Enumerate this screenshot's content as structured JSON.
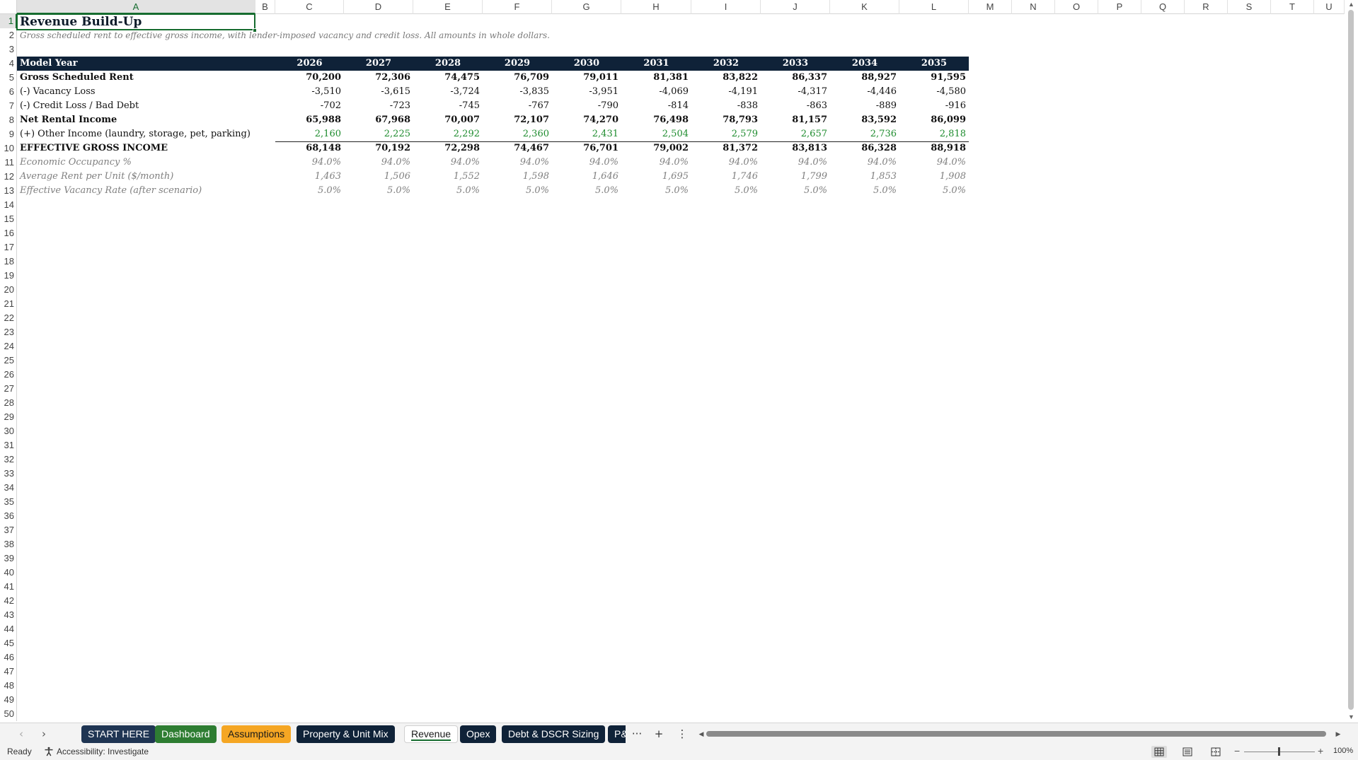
{
  "columns": [
    "A",
    "B",
    "C",
    "D",
    "E",
    "F",
    "G",
    "H",
    "I",
    "J",
    "K",
    "L",
    "M",
    "N",
    "O",
    "P",
    "Q",
    "R",
    "S",
    "T",
    "U"
  ],
  "active_column": "A",
  "row_numbers": [
    "1",
    "2",
    "3",
    "4",
    "5",
    "6",
    "7",
    "8",
    "9",
    "10",
    "11",
    "12",
    "13",
    "14",
    "15",
    "16",
    "17",
    "18",
    "19",
    "20",
    "21",
    "22",
    "23",
    "24",
    "25",
    "26",
    "27",
    "28",
    "29",
    "30",
    "31",
    "32",
    "33",
    "34",
    "35",
    "36",
    "37",
    "38",
    "39",
    "40",
    "41",
    "42",
    "43",
    "44",
    "45",
    "46",
    "47",
    "48",
    "49",
    "50"
  ],
  "active_row": "1",
  "sheet": {
    "title": "Revenue Build-Up",
    "subtitle": "Gross scheduled rent to effective gross income, with lender-imposed vacancy and credit loss. All amounts in whole dollars.",
    "header_label": "Model Year",
    "years": [
      "2026",
      "2027",
      "2028",
      "2029",
      "2030",
      "2031",
      "2032",
      "2033",
      "2034",
      "2035"
    ],
    "rows": [
      {
        "label": "Gross Scheduled Rent",
        "style": "bold",
        "values": [
          "70,200",
          "72,306",
          "74,475",
          "76,709",
          "79,011",
          "81,381",
          "83,822",
          "86,337",
          "88,927",
          "91,595"
        ]
      },
      {
        "label": "(-) Vacancy Loss",
        "style": "normal",
        "values": [
          "-3,510",
          "-3,615",
          "-3,724",
          "-3,835",
          "-3,951",
          "-4,069",
          "-4,191",
          "-4,317",
          "-4,446",
          "-4,580"
        ]
      },
      {
        "label": "(-) Credit Loss / Bad Debt",
        "style": "normal",
        "values": [
          "-702",
          "-723",
          "-745",
          "-767",
          "-790",
          "-814",
          "-838",
          "-863",
          "-889",
          "-916"
        ]
      },
      {
        "label": "Net Rental Income",
        "style": "bold",
        "values": [
          "65,988",
          "67,968",
          "70,007",
          "72,107",
          "74,270",
          "76,498",
          "78,793",
          "81,157",
          "83,592",
          "86,099"
        ]
      },
      {
        "label": "(+) Other Income (laundry, storage, pet, parking)",
        "style": "green",
        "values": [
          "2,160",
          "2,225",
          "2,292",
          "2,360",
          "2,431",
          "2,504",
          "2,579",
          "2,657",
          "2,736",
          "2,818"
        ]
      },
      {
        "label": "EFFECTIVE GROSS INCOME",
        "style": "bold",
        "values": [
          "68,148",
          "70,192",
          "72,298",
          "74,467",
          "76,701",
          "79,002",
          "81,372",
          "83,813",
          "86,328",
          "88,918"
        ]
      },
      {
        "label": "Economic Occupancy %",
        "style": "italic",
        "values": [
          "94.0%",
          "94.0%",
          "94.0%",
          "94.0%",
          "94.0%",
          "94.0%",
          "94.0%",
          "94.0%",
          "94.0%",
          "94.0%"
        ]
      },
      {
        "label": "Average Rent per Unit ($/month)",
        "style": "italic",
        "values": [
          "1,463",
          "1,506",
          "1,552",
          "1,598",
          "1,646",
          "1,695",
          "1,746",
          "1,799",
          "1,853",
          "1,908"
        ]
      },
      {
        "label": "Effective Vacancy Rate (after scenario)",
        "style": "italic",
        "values": [
          "5.0%",
          "5.0%",
          "5.0%",
          "5.0%",
          "5.0%",
          "5.0%",
          "5.0%",
          "5.0%",
          "5.0%",
          "5.0%"
        ]
      }
    ]
  },
  "tabs": [
    {
      "label": "START HERE",
      "bg": "#1f3553",
      "fg": "#ffffff"
    },
    {
      "label": "Dashboard",
      "bg": "#2e7d32",
      "fg": "#ffffff"
    },
    {
      "label": "Assumptions",
      "bg": "#f5a623",
      "fg": "#1a1a1a"
    },
    {
      "label": "Property & Unit Mix",
      "bg": "#0f2238",
      "fg": "#ffffff"
    },
    {
      "label": "Revenue",
      "bg": "#ffffff",
      "fg": "#1a1a1a",
      "active": true
    },
    {
      "label": "Opex",
      "bg": "#0f2238",
      "fg": "#ffffff"
    },
    {
      "label": "Debt & DSCR Sizing",
      "bg": "#0f2238",
      "fg": "#ffffff"
    },
    {
      "label": "P&",
      "bg": "#0f2238",
      "fg": "#ffffff"
    }
  ],
  "tab_bar": {
    "prev_icon": "chevron-left-icon",
    "prev_glyph": "‹",
    "next_icon": "chevron-right-icon",
    "next_glyph": "›",
    "more_glyph": "···",
    "add_glyph": "+",
    "options_glyph": "⋮"
  },
  "status": {
    "ready": "Ready",
    "accessibility": "Accessibility: Investigate",
    "zoom": "100%",
    "zoom_minus": "−",
    "zoom_plus": "+"
  },
  "colors": {
    "header_band": "#0f2238",
    "selection": "#166c2f",
    "green_text": "#1e8c2e"
  }
}
